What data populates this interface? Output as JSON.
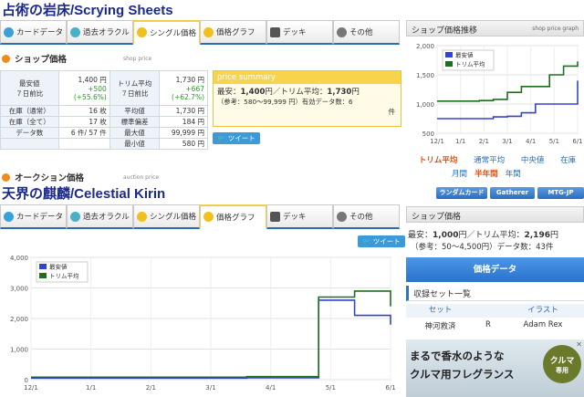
{
  "card1": {
    "title": "占術の岩床/Scrying Sheets",
    "tabs": [
      "カードデータ",
      "過去オラクル",
      "シングル価格",
      "価格グラフ",
      "デッキ",
      "その他"
    ],
    "active_tab": 2,
    "shop_heading": "ショップ価格",
    "shop_sub": "shop price",
    "price_table": {
      "low_label": "最安値",
      "low_value": "1,400 円",
      "week_label": "７日前比",
      "week_value": "+500",
      "week_pct": "(+55.6%)",
      "trim_label": "トリム平均",
      "trim_value": "1,730 円",
      "trim_week_label": "７日前比",
      "trim_week_value": "+667",
      "trim_week_pct": "(+62.7%)",
      "rows": [
        {
          "l1": "在庫（通常）",
          "v1": "16 枚",
          "l2": "平均値",
          "v2": "1,730 円"
        },
        {
          "l1": "在庫（全て）",
          "v1": "17 枚",
          "l2": "標準偏差",
          "v2": "184 円"
        },
        {
          "l1": "データ数",
          "v1": "6 件/ 57 件",
          "l2": "最大値",
          "v2": "99,999 円"
        },
        {
          "l1": "",
          "v1": "",
          "l2": "最小値",
          "v2": "580 円"
        }
      ]
    },
    "summary": {
      "head": "price summary",
      "line1a": "最安：",
      "line1b": "1,400",
      "line1c": "円／トリム平均：",
      "line1d": "1,730",
      "line1e": "円",
      "line2": "（参考：580〜99,999 円）有効データ数：6",
      "line3": "件"
    },
    "tweet": "ツイート",
    "auction_heading": "オークション価格",
    "auction_sub": "auction price",
    "graph_head": "ショップ価格推移",
    "graph_sub": "shop price graph",
    "graph_links1": [
      "トリム平均",
      "通常平均",
      "中央値",
      "在庫"
    ],
    "graph_links2": [
      "月間",
      "半年間",
      "年間"
    ],
    "side_buttons": [
      "ランダムカード",
      "Gatherer",
      "MTG-JP"
    ]
  },
  "card2": {
    "title": "天界の麒麟/Celestial Kirin",
    "tabs": [
      "カードデータ",
      "過去オラクル",
      "シングル価格",
      "価格グラフ",
      "デッキ",
      "その他"
    ],
    "active_tab": 3,
    "tweet": "ツイート",
    "shop_head": "ショップ価格",
    "shop_line1a": "最安：",
    "shop_line1b": "1,000",
    "shop_line1c": "円／トリム平均：",
    "shop_line1d": "2,196",
    "shop_line1e": "円",
    "shop_line2": "（参考：50〜4,500円）データ数：43件",
    "price_data_btn": "価格データ",
    "set_head": "収録セット一覧",
    "set_cols": [
      "セット",
      "",
      "イラスト"
    ],
    "set_row": [
      "神河救済",
      "R",
      "Adam Rex"
    ],
    "ad_line1": "まるで香水のような",
    "ad_line2": "クルマ用フレグランス",
    "ad_badge1": "クルマ",
    "ad_badge2": "専用"
  },
  "chart_data": [
    {
      "type": "line",
      "x": [
        "12/1",
        "1/1",
        "2/1",
        "3/1",
        "4/1",
        "5/1",
        "6/1"
      ],
      "ylim": [
        500,
        2000
      ],
      "yticks": [
        "500",
        "1,000",
        "1,500",
        "2,000"
      ],
      "series": [
        {
          "name": "最安値",
          "color": "#3344cc",
          "values": [
            750,
            750,
            750,
            750,
            780,
            790,
            850,
            1000,
            1000,
            1000,
            1400
          ]
        },
        {
          "name": "トリム平均",
          "color": "#1e6e1e",
          "values": [
            1050,
            1050,
            1050,
            1060,
            1080,
            1200,
            1300,
            1300,
            1500,
            1650,
            1730
          ]
        }
      ],
      "legend": "top-left"
    },
    {
      "type": "line",
      "x": [
        "12/1",
        "1/1",
        "2/1",
        "3/1",
        "4/1",
        "5/1",
        "6/1"
      ],
      "ylim": [
        0,
        4000
      ],
      "yticks": [
        "0",
        "1,000",
        "2,000",
        "3,000",
        "4,000"
      ],
      "series": [
        {
          "name": "最安値",
          "color": "#3344cc",
          "values": [
            50,
            50,
            50,
            50,
            50,
            50,
            60,
            60,
            2600,
            2100,
            1800
          ]
        },
        {
          "name": "トリム平均",
          "color": "#1e6e1e",
          "values": [
            80,
            80,
            80,
            80,
            80,
            80,
            100,
            100,
            2700,
            2900,
            2400
          ]
        }
      ],
      "legend": "top-left"
    }
  ]
}
